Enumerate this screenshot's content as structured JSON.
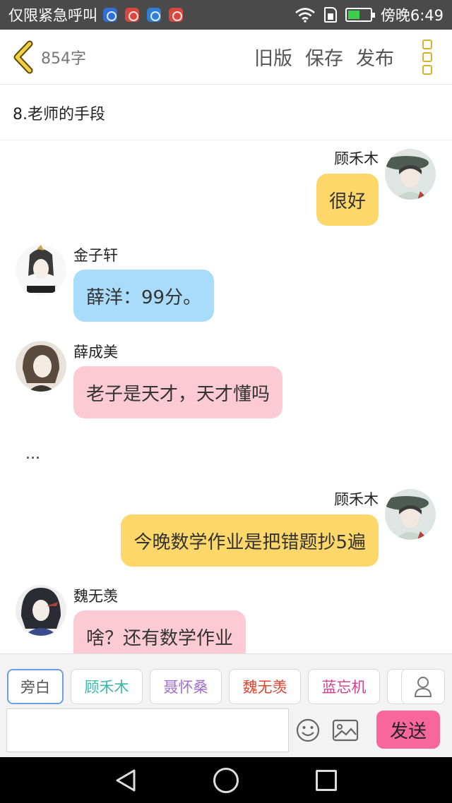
{
  "status_bar": {
    "carrier": "仅限紧急呼叫",
    "app_icons": [
      {
        "icon": "k-app-icon",
        "color": "#2f6fd6"
      },
      {
        "icon": "mail-app-icon",
        "color": "#d9473f"
      },
      {
        "icon": "gallery-app-icon",
        "color": "#2f7fd6"
      },
      {
        "icon": "recorder-app-icon",
        "color": "#d9473f"
      }
    ],
    "time": "傍晚6:49"
  },
  "header": {
    "word_count": "854字",
    "old_version_label": "旧版",
    "save_label": "保存",
    "publish_label": "发布"
  },
  "chapter_title": "8.老师的手段",
  "messages": {
    "m1": {
      "speaker": "顾禾木",
      "text": "很好",
      "side": "right",
      "color": "#fdd769"
    },
    "m2": {
      "speaker": "金子轩",
      "text": "薛洋：99分。",
      "side": "left",
      "color": "#a8dcfa"
    },
    "m3": {
      "speaker": "薛成美",
      "text": "老子是天才，天才懂吗",
      "side": "left",
      "color": "#fbcad5"
    },
    "narration": "...",
    "m4": {
      "speaker": "顾禾木",
      "text": "今晚数学作业是把错题抄5遍",
      "side": "right",
      "color": "#fdd769"
    },
    "m5": {
      "speaker": "魏无羡",
      "text": "啥？还有数学作业",
      "side": "left",
      "color": "#fbcad5"
    }
  },
  "roles": [
    {
      "label": "旁白",
      "color": "#555555"
    },
    {
      "label": "顾禾木",
      "color": "#3bb8a6"
    },
    {
      "label": "聂怀桑",
      "color": "#a06fd0"
    },
    {
      "label": "魏无羡",
      "color": "#e0442f"
    },
    {
      "label": "蓝忘机",
      "color": "#d8408f"
    }
  ],
  "input": {
    "placeholder": ""
  },
  "send_label": "发送"
}
